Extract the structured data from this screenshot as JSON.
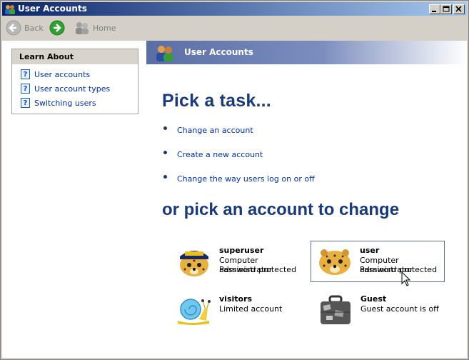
{
  "window": {
    "title": "User Accounts"
  },
  "toolbar": {
    "back_label": "Back",
    "home_label": "Home"
  },
  "sidebar": {
    "learn_title": "Learn About",
    "items": [
      {
        "label": "User accounts"
      },
      {
        "label": "User account types"
      },
      {
        "label": "Switching users"
      }
    ]
  },
  "main": {
    "header_title": "User Accounts",
    "heading_tasks": "Pick a task...",
    "tasks": [
      {
        "label": "Change an account"
      },
      {
        "label": "Create a new account"
      },
      {
        "label": "Change the way users log on or off"
      }
    ],
    "heading_accounts": "or pick an account to change",
    "accounts": [
      {
        "name": "superuser",
        "line1": "Computer administrator",
        "line2": "Password protected",
        "icon": "cheetah-admin-cap-icon"
      },
      {
        "name": "user",
        "line1": "Computer administrator",
        "line2": "Password protected",
        "icon": "cheetah-icon"
      },
      {
        "name": "visitors",
        "line1": "Limited account",
        "line2": "",
        "icon": "snail-icon"
      },
      {
        "name": "Guest",
        "line1": "Guest account is off",
        "line2": "",
        "icon": "suitcase-icon"
      }
    ]
  },
  "colors": {
    "title_bar": "#0a246a",
    "heading": "#1a3a7a",
    "link": "#0030b0",
    "header_band": "#5a6ea6"
  }
}
